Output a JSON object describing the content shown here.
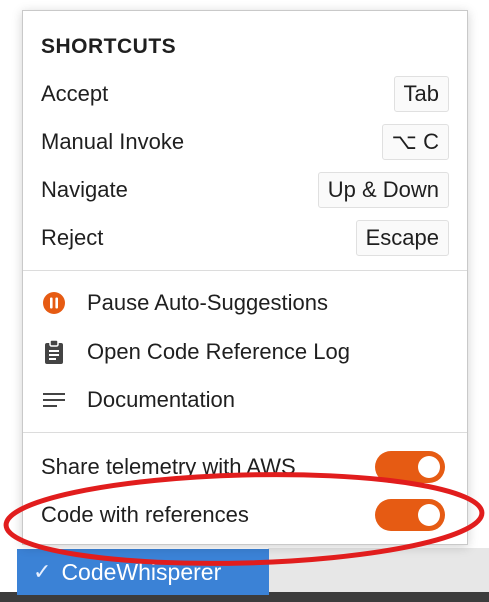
{
  "shortcuts": {
    "title": "SHORTCUTS",
    "items": [
      {
        "label": "Accept",
        "key": "Tab"
      },
      {
        "label": "Manual Invoke",
        "key": "⌥ C"
      },
      {
        "label": "Navigate",
        "key": "Up & Down"
      },
      {
        "label": "Reject",
        "key": "Escape"
      }
    ]
  },
  "actions": [
    {
      "label": "Pause Auto-Suggestions",
      "icon": "pause-circle-icon"
    },
    {
      "label": "Open Code Reference Log",
      "icon": "clipboard-icon"
    },
    {
      "label": "Documentation",
      "icon": "lines-icon"
    }
  ],
  "toggles": [
    {
      "label": "Share telemetry with AWS",
      "state": "on"
    },
    {
      "label": "Code with references",
      "state": "on"
    }
  ],
  "status_bar": {
    "label": "CodeWhisperer",
    "check": "✓"
  },
  "colors": {
    "accent_orange": "#e65b13",
    "status_blue": "#3b82d6",
    "annotation_red": "#e11d1d"
  }
}
